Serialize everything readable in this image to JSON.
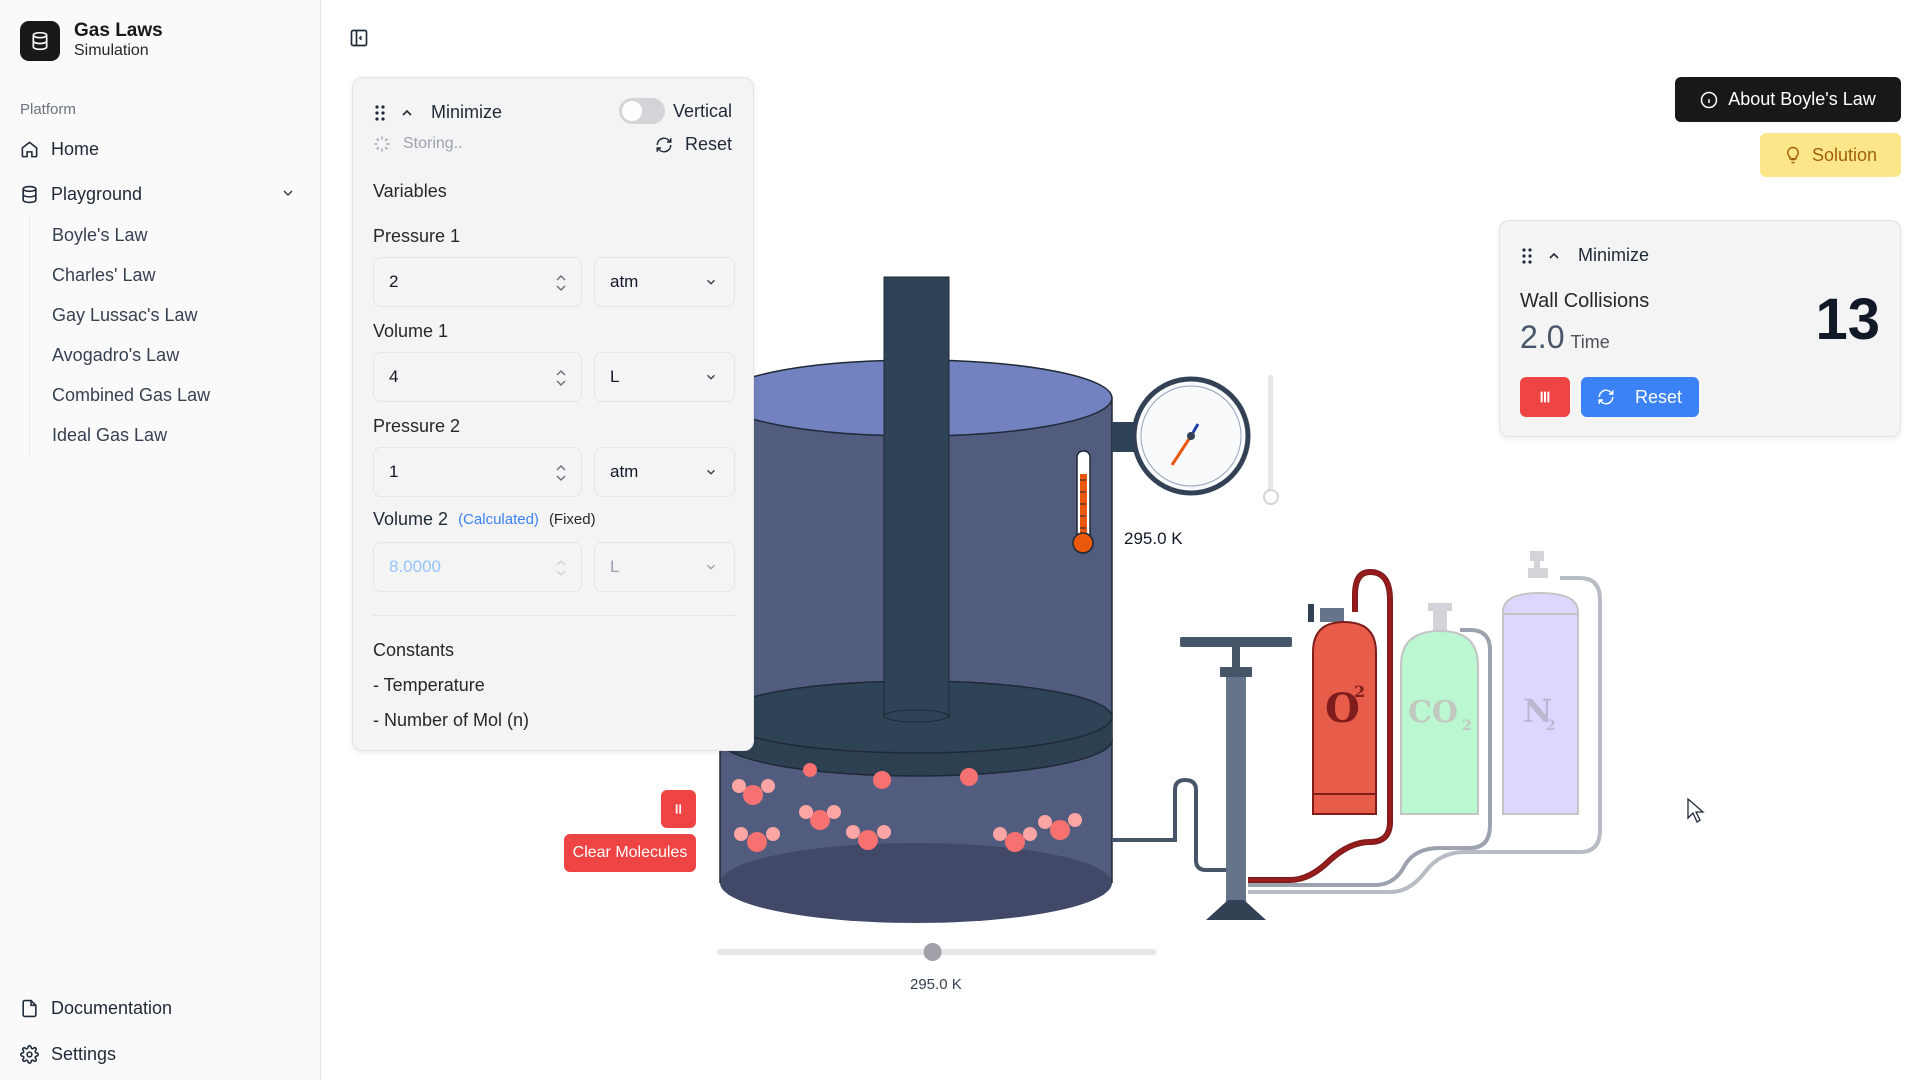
{
  "app": {
    "title": "Gas Laws",
    "subtitle": "Simulation"
  },
  "sidebar": {
    "group_label": "Platform",
    "home": "Home",
    "playground": "Playground",
    "laws": [
      "Boyle's Law",
      "Charles' Law",
      "Gay Lussac's Law",
      "Avogadro's Law",
      "Combined Gas Law",
      "Ideal Gas Law"
    ],
    "documentation": "Documentation",
    "settings": "Settings"
  },
  "control_panel": {
    "minimize": "Minimize",
    "vertical": "Vertical",
    "status": "Storing..",
    "reset": "Reset",
    "variables": "Variables",
    "pressure1": {
      "label": "Pressure 1",
      "value": "2",
      "unit": "atm"
    },
    "volume1": {
      "label": "Volume 1",
      "value": "4",
      "unit": "L"
    },
    "pressure2": {
      "label": "Pressure 2",
      "value": "1",
      "unit": "atm"
    },
    "volume2": {
      "label": "Volume 2",
      "calculated": "(Calculated)",
      "fixed": "(Fixed)",
      "value": "8.0000",
      "unit": "L"
    },
    "constants_title": "Constants",
    "constants": [
      "- Temperature",
      "- Number of Mol (n)"
    ]
  },
  "actions": {
    "about": "About Boyle's Law",
    "solution": "Solution"
  },
  "info_panel": {
    "minimize": "Minimize",
    "title": "Wall Collisions",
    "time_value": "2.0",
    "time_label": "Time",
    "count": "13",
    "reset": "Reset"
  },
  "simulation": {
    "clear_molecules": "Clear Molecules",
    "thermo_readout": "295.0 K",
    "slider_readout": "295.0 K",
    "slider_fraction": 0.49,
    "tanks": {
      "o2": "O",
      "o2_sup": "2",
      "co2": "CO",
      "co2_sub": "2",
      "n2": "N",
      "n2_sub": "2"
    }
  },
  "colors": {
    "accent_blue": "#3b82f6",
    "danger": "#ef4444",
    "solution": "#fde68a",
    "chamber": "#525c7e",
    "gas": "#7282c0"
  }
}
